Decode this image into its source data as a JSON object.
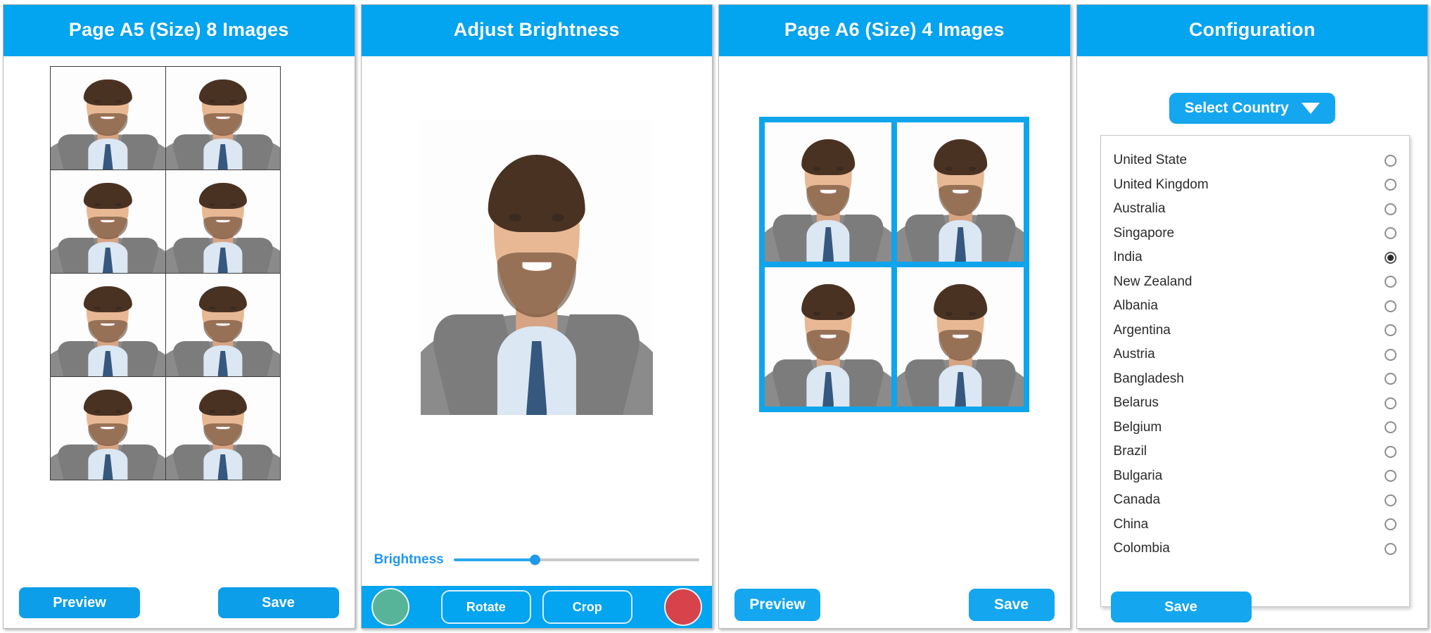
{
  "theme": {
    "accent_blue": "#03a4f0",
    "button_blue": "#14a6ee",
    "slider_blue": "#29a8f0",
    "green_button": "#58b498",
    "red_button": "#d6434b",
    "panel_border": "#b9b9b9",
    "text_dark": "#2b2b2b"
  },
  "panel_a5": {
    "title": "Page A5 (Size) 8 Images",
    "photo_count": 8,
    "columns": 2,
    "rows": 4,
    "buttons": [
      {
        "label": "Preview"
      },
      {
        "label": "Save"
      }
    ]
  },
  "panel_brightness": {
    "title": "Adjust Brightness",
    "slider": {
      "label": "Brightness",
      "value_percent": 33
    },
    "toolbar": {
      "left_round_button": "accept-button",
      "right_round_button": "cancel-button",
      "middle_buttons": [
        {
          "label": "Rotate"
        },
        {
          "label": "Crop"
        }
      ]
    }
  },
  "panel_a6": {
    "title": "Page A6 (Size) 4 Images",
    "photo_count": 4,
    "columns": 2,
    "rows": 2,
    "buttons": [
      {
        "label": "Preview"
      },
      {
        "label": "Save"
      }
    ]
  },
  "panel_config": {
    "title": "Configuration",
    "select_button": {
      "label": "Select Country",
      "icon": "chevron-down-icon"
    },
    "save_button": {
      "label": "Save"
    },
    "countries": [
      {
        "name": "United State",
        "selected": false
      },
      {
        "name": "United Kingdom",
        "selected": false
      },
      {
        "name": "Australia",
        "selected": false
      },
      {
        "name": "Singapore",
        "selected": false
      },
      {
        "name": "India",
        "selected": true
      },
      {
        "name": "New Zealand",
        "selected": false
      },
      {
        "name": "Albania",
        "selected": false
      },
      {
        "name": "Argentina",
        "selected": false
      },
      {
        "name": "Austria",
        "selected": false
      },
      {
        "name": "Bangladesh",
        "selected": false
      },
      {
        "name": "Belarus",
        "selected": false
      },
      {
        "name": "Belgium",
        "selected": false
      },
      {
        "name": "Brazil",
        "selected": false
      },
      {
        "name": "Bulgaria",
        "selected": false
      },
      {
        "name": "Canada",
        "selected": false
      },
      {
        "name": "China",
        "selected": false
      },
      {
        "name": "Colombia",
        "selected": false
      }
    ]
  }
}
